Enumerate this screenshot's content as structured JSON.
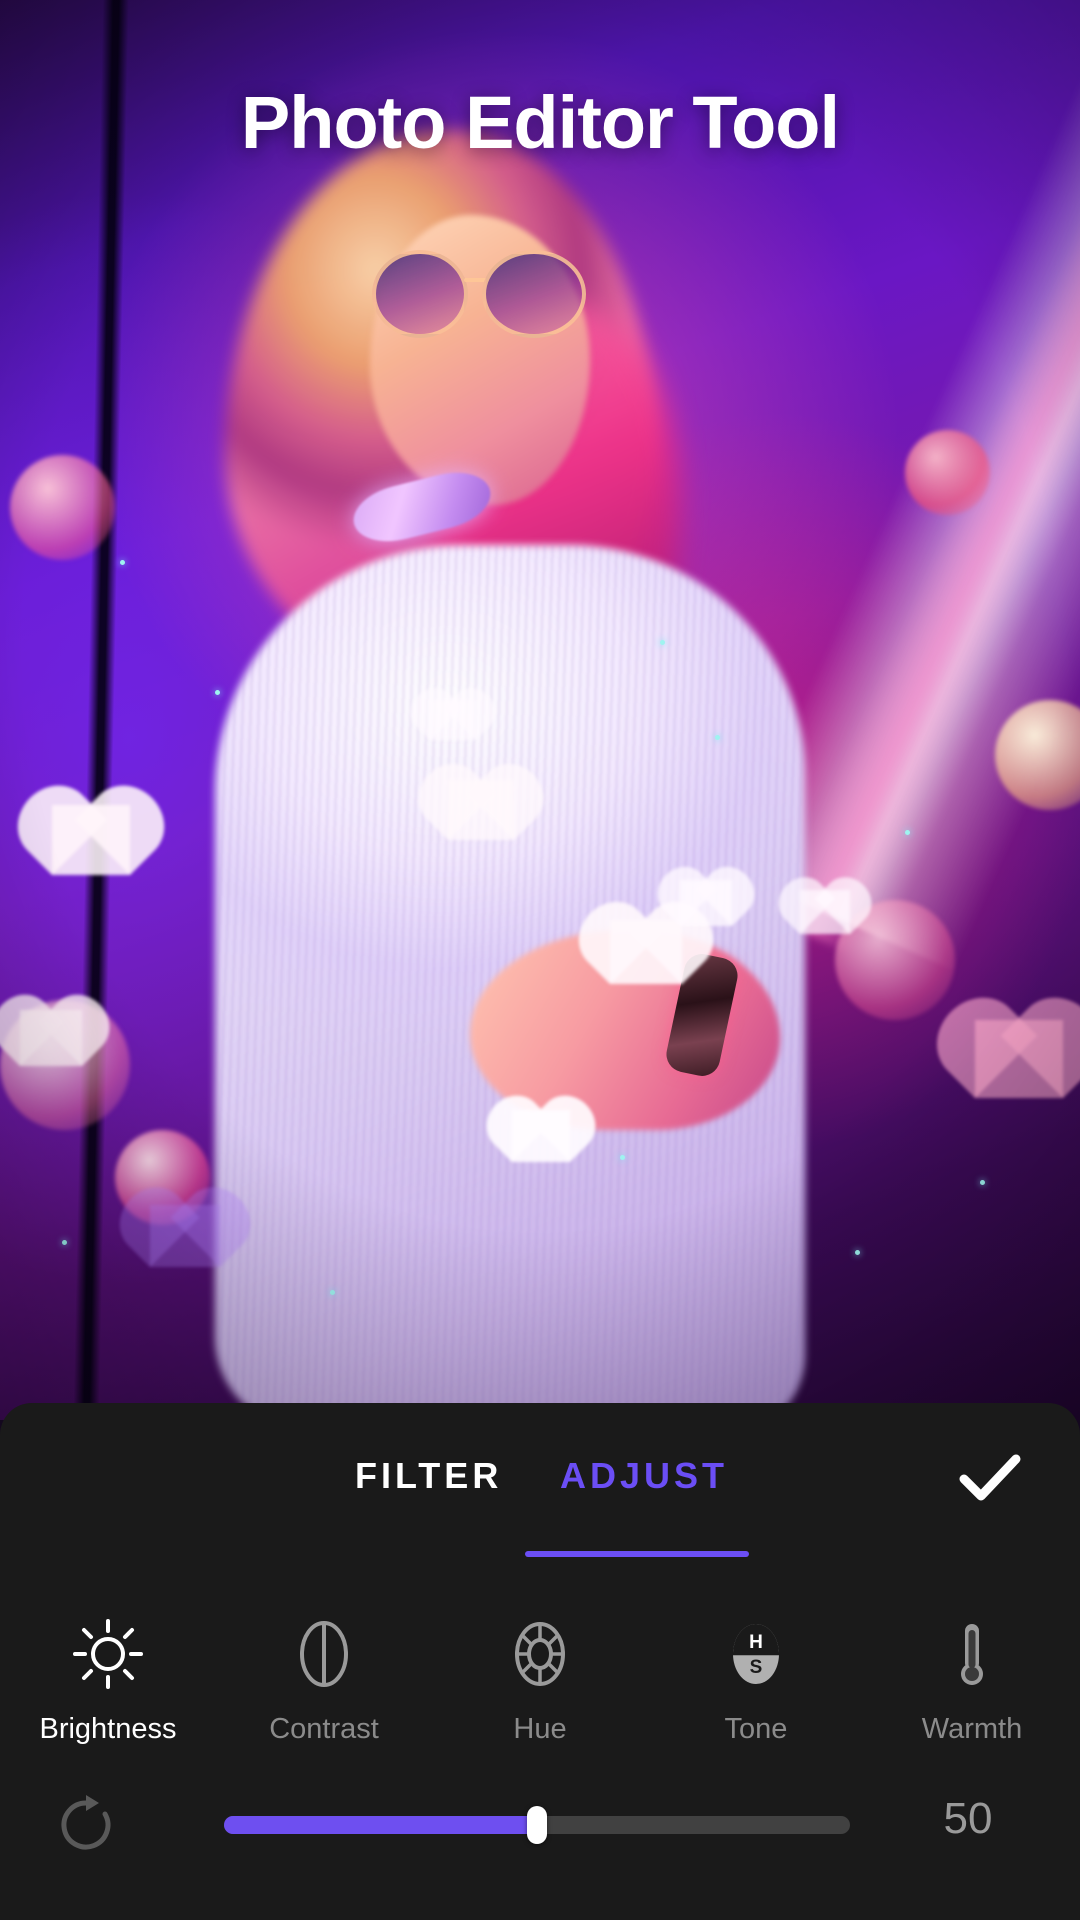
{
  "app": {
    "title": "Photo Editor Tool",
    "accent_color": "#6B4EF5",
    "panel_color": "#1a1a1a"
  },
  "tabs": [
    {
      "label": "FILTER",
      "active": false,
      "color": "#FFFFFF"
    },
    {
      "label": "ADJUST",
      "active": true,
      "color": "#6B4EF5"
    }
  ],
  "actions": {
    "confirm_icon": "check-icon",
    "reset_icon": "reset-rotate-icon"
  },
  "tools": [
    {
      "label": "Brightness",
      "icon": "brightness-sun-icon",
      "active": true
    },
    {
      "label": "Contrast",
      "icon": "contrast-circle-icon",
      "active": false
    },
    {
      "label": "Hue",
      "icon": "hue-wheel-icon",
      "active": false
    },
    {
      "label": "Tone",
      "icon": "tone-hs-icon",
      "active": false
    },
    {
      "label": "Warmth",
      "icon": "warmth-thermometer-icon",
      "active": false
    }
  ],
  "slider": {
    "value": "50",
    "percent": 50,
    "min": 0,
    "max": 100,
    "fill_color": "#6E4FF0",
    "track_color": "#414141",
    "thumb_color": "#FFFFFF"
  }
}
